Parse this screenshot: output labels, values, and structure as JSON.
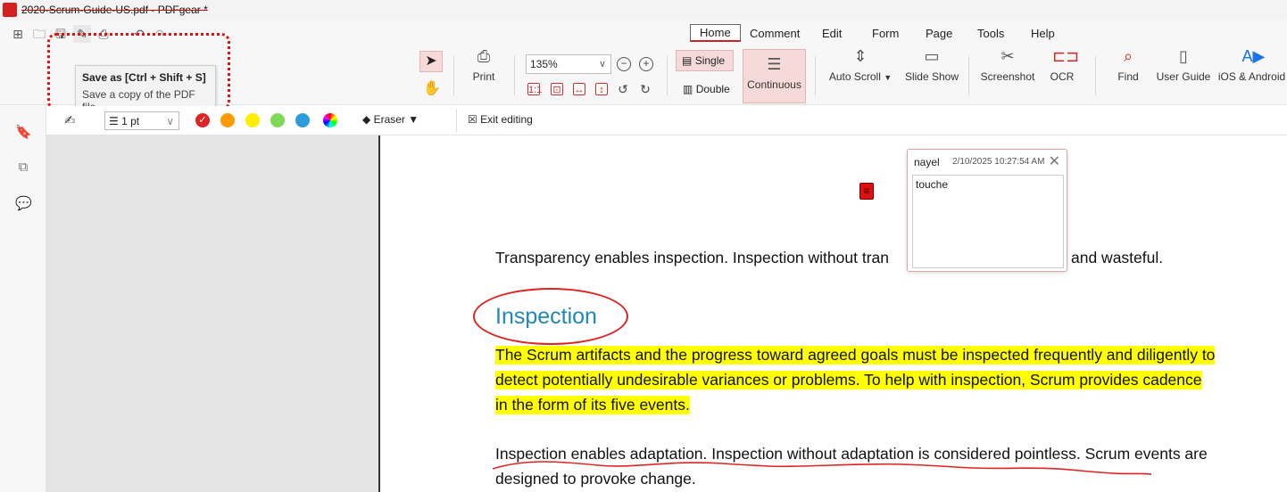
{
  "window": {
    "title": "2020-Scrum-Guide-US.pdf - PDFgear *"
  },
  "menu": [
    {
      "label": "Home",
      "active": true
    },
    {
      "label": "Comment"
    },
    {
      "label": "Edit"
    },
    {
      "label": "Form"
    },
    {
      "label": "Page"
    },
    {
      "label": "Tools"
    },
    {
      "label": "Help"
    }
  ],
  "tooltip": {
    "title": "Save as  [Ctrl + Shift + S]",
    "desc": "Save a copy of the PDF file."
  },
  "toolbar": {
    "print": "Print",
    "zoom": "135%",
    "single": "Single",
    "double": "Double",
    "continuous": "Continuous",
    "auto_scroll": "Auto Scroll",
    "slide_show": "Slide Show",
    "screenshot": "Screenshot",
    "ocr": "OCR",
    "find": "Find",
    "user_guide": "User Guide",
    "ios_android": "iOS & Android"
  },
  "annobar": {
    "stroke": "1 pt",
    "eraser": "Eraser",
    "exit": "Exit editing",
    "colors": [
      "#e02424",
      "#ff9a00",
      "#ffee00",
      "#7ed957",
      "#2d9cdb"
    ]
  },
  "comment": {
    "author": "nayel",
    "time": "2/10/2025 10:27:54 AM",
    "text": "touche"
  },
  "doc": {
    "line1a": "Transparency enables inspection. Inspection without tran",
    "line1b": "and wasteful.",
    "heading": "Inspection",
    "p1": "The Scrum artifacts and the progress toward agreed goals must be inspected frequently and diligently to",
    "p2": "detect potentially undesirable variances or problems. To help with inspection, Scrum provides cadence",
    "p3": "in the form of its five events.",
    "p4": "Inspection enables adaptation. Inspection without adaptation is considered pointless. Scrum events are",
    "p5": "designed to provoke change."
  }
}
